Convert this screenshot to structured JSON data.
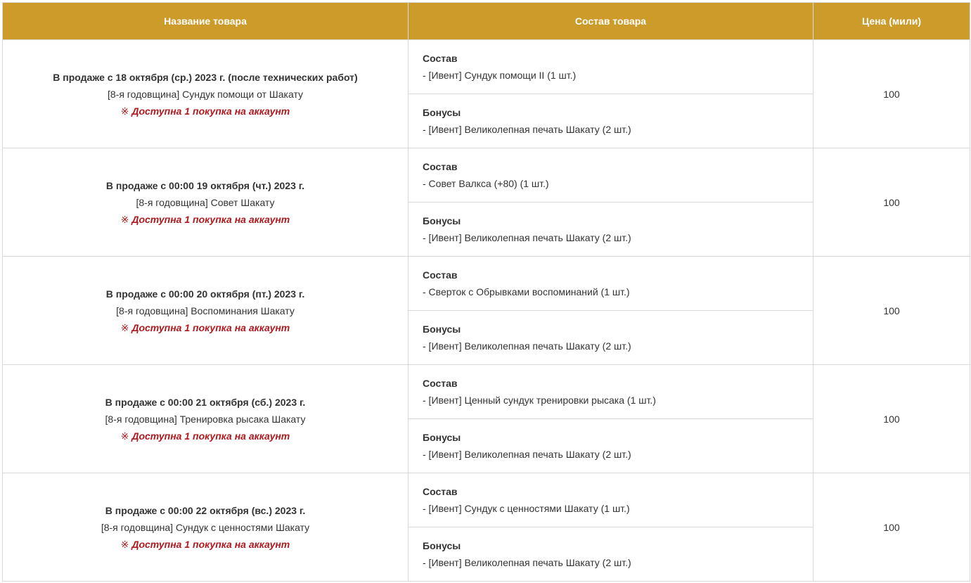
{
  "table": {
    "headers": {
      "name": "Название товара",
      "contents": "Состав товара",
      "price": "Цена (мили)"
    },
    "rows": [
      {
        "sale_date": "В продаже с 18 октября (ср.) 2023 г. (после технических работ)",
        "item_name": "[8-я годовщина] Сундук помощи от Шакату",
        "limit_mark": "※",
        "limit_text": "Доступна 1 покупка на аккаунт",
        "composition_title": "Состав",
        "composition_item": "- [Ивент] Сундук помощи II (1 шт.)",
        "bonus_title": "Бонусы",
        "bonus_item": "- [Ивент] Великолепная печать Шакату (2 шт.)",
        "price": "100"
      },
      {
        "sale_date": "В продаже с 00:00 19 октября (чт.) 2023 г.",
        "item_name": "[8-я годовщина] Совет Шакату",
        "limit_mark": "※",
        "limit_text": "Доступна 1 покупка на аккаунт",
        "composition_title": "Состав",
        "composition_item": "- Совет Валкса (+80) (1 шт.)",
        "bonus_title": "Бонусы",
        "bonus_item": "- [Ивент] Великолепная печать Шакату (2 шт.)",
        "price": "100"
      },
      {
        "sale_date": "В продаже с 00:00 20 октября (пт.) 2023 г.",
        "item_name": "[8-я годовщина] Воспоминания Шакату",
        "limit_mark": "※",
        "limit_text": "Доступна 1 покупка на аккаунт",
        "composition_title": "Состав",
        "composition_item": "- Сверток с Обрывками воспоминаний (1 шт.)",
        "bonus_title": "Бонусы",
        "bonus_item": "- [Ивент] Великолепная печать Шакату (2 шт.)",
        "price": "100"
      },
      {
        "sale_date": "В продаже с 00:00 21 октября (сб.) 2023 г.",
        "item_name": "[8-я годовщина] Тренировка рысака Шакату",
        "limit_mark": "※",
        "limit_text": "Доступна 1 покупка на аккаунт",
        "composition_title": "Состав",
        "composition_item": "- [Ивент] Ценный сундук тренировки рысака (1 шт.)",
        "bonus_title": "Бонусы",
        "bonus_item": "- [Ивент] Великолепная печать Шакату (2 шт.)",
        "price": "100"
      },
      {
        "sale_date": "В продаже с 00:00 22 октября (вс.) 2023 г.",
        "item_name": "[8-я годовщина] Сундук с ценностями Шакату",
        "limit_mark": "※",
        "limit_text": "Доступна 1 покупка на аккаунт",
        "composition_title": "Состав",
        "composition_item": "- [Ивент] Сундук с ценностями Шакату (1 шт.)",
        "bonus_title": "Бонусы",
        "bonus_item": "- [Ивент] Великолепная печать Шакату (2 шт.)",
        "price": "100"
      }
    ]
  },
  "colors": {
    "header_bg": "#cc9b2a",
    "border": "#d9d9d9",
    "limit_text": "#b0191e"
  }
}
